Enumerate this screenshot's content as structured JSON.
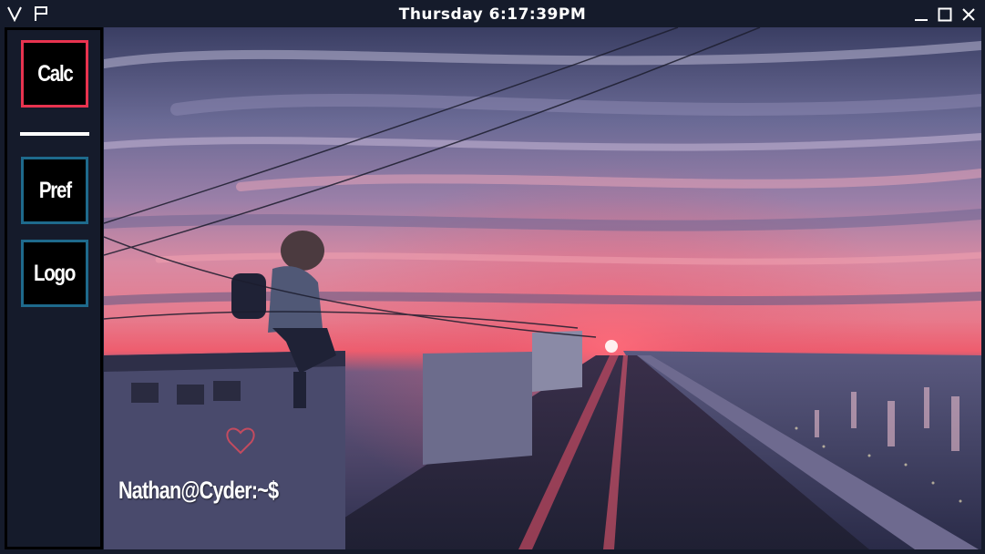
{
  "titlebar": {
    "clock": "Thursday 6:17:39PM"
  },
  "sidebar": {
    "buttons": [
      {
        "label": "Calc",
        "accent": "#e8334f"
      },
      {
        "label": "Pref",
        "accent": "#1e6a8c"
      },
      {
        "label": "Logo",
        "accent": "#1e6a8c"
      }
    ]
  },
  "desktop": {
    "prompt": "Nathan@Cyder:~$"
  },
  "icons": {
    "app_logo": "v-logo-icon",
    "pin": "pin-icon",
    "minimize": "minimize-icon",
    "maximize": "maximize-icon",
    "close": "close-icon"
  },
  "colors": {
    "chrome": "#151b2b",
    "calc_border": "#e8334f",
    "pref_border": "#1e6a8c"
  }
}
